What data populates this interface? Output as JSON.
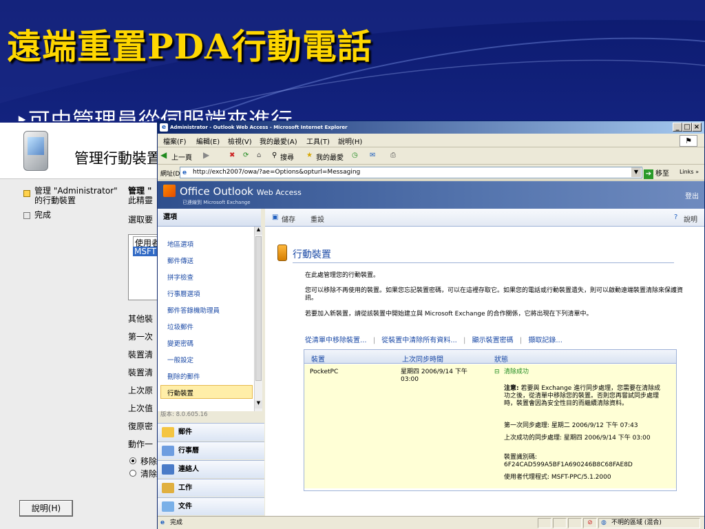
{
  "slide": {
    "title": "遠端重置PDA行動電話",
    "bullet": "‣可由管理員從伺服端來進行"
  },
  "bg_dialog": {
    "title": "管理行動裝置",
    "steps": [
      "管理 \"Administrator\"",
      "的行動裝置",
      "完成"
    ],
    "mid_header": "管理 \"",
    "mid_sub": "此精靈",
    "choose": "選取要",
    "list_header": "使用者",
    "list_value": "MSFT",
    "labels": [
      "其他裝",
      "第一次",
      "裝置清",
      "裝置清",
      "上次原",
      "上次值",
      "復原密",
      "動作一"
    ],
    "radios": [
      "移除",
      "清除"
    ],
    "help_button": "說明(H)"
  },
  "ie": {
    "title": "Administrator - Outlook Web Access - Microsoft Internet Explorer",
    "menu": [
      "檔案(F)",
      "編輯(E)",
      "檢視(V)",
      "我的最愛(A)",
      "工具(T)",
      "說明(H)"
    ],
    "toolbar": {
      "back": "上一頁",
      "search": "搜尋",
      "favorites": "我的最愛"
    },
    "address_label": "網址(D)",
    "address": "http://exch2007/owa/?ae=Options&opturl=Messaging",
    "go": "移至",
    "links": "Links",
    "status": "完成",
    "zone": "不明的區域 (混合)"
  },
  "owa": {
    "brand": "Office Outlook",
    "brand_sub": "Web Access",
    "powered": "已連線到 Microsoft Exchange",
    "logout": "登出",
    "nav_header": "選項",
    "nav_items": [
      "地區選項",
      "郵件傳送",
      "拼字檢查",
      "行事曆選項",
      "郵件答錄機助理員",
      "垃圾郵件",
      "變更密碼",
      "一般設定",
      "刪除的郵件",
      "行動裝置"
    ],
    "version": "版本: 8.0.605.16",
    "modules": [
      "郵件",
      "行事曆",
      "連絡人",
      "工作",
      "文件"
    ],
    "save": "儲存",
    "reset": "重設",
    "help": "說明",
    "heading": "行動裝置",
    "p1": "在此處管理您的行動裝置。",
    "p2": "您可以移除不再使用的裝置。如果您忘記裝置密碼，可以在這裡存取它。如果您的電話或行動裝置遺失，則可以啟動遠端裝置清除來保護資訊。",
    "p3": "若要加入新裝置，請從該裝置中開始建立與 Microsoft Exchange 的合作關係，它將出現在下列清單中。",
    "links": [
      "從清單中移除裝置...",
      "從裝置中清除所有資料...",
      "顯示裝置密碼",
      "擷取記錄..."
    ],
    "table": {
      "headers": [
        "裝置",
        "上次同步時間",
        "狀態"
      ],
      "device": "PocketPC",
      "last_sync": "星期四 2006/9/14 下午 03:00",
      "status": "清除成功",
      "note_label": "注意:",
      "note": "若要與 Exchange 進行同步處理，您需要在清除成功之後，從清單中移除您的裝置。否則您再嘗試同步處理時，裝置會因為安全性目的而繼續清除資料。",
      "first_sync": "第一次同步處理: 星期二 2006/9/12 下午 07:43",
      "last_success": "上次成功的同步處理: 星期四 2006/9/14 下午 03:00",
      "device_id_label": "裝置識別碼:",
      "device_id": "6F24CAD599A5BF1A690246B8C68FAE8D",
      "agent": "使用者代理程式: MSFT-PPC/5.1.2000"
    }
  }
}
